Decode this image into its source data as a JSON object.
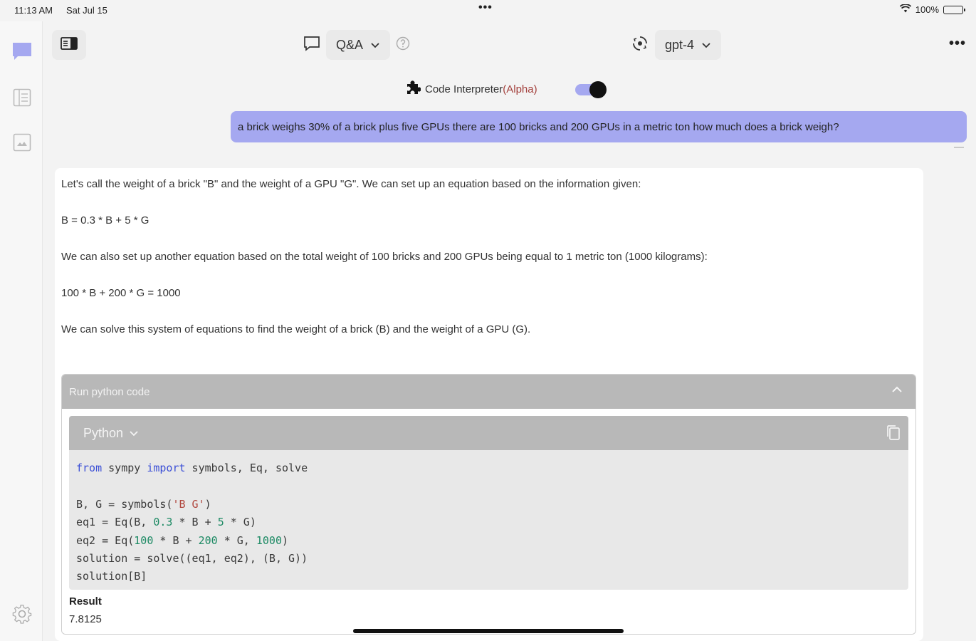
{
  "status_bar": {
    "time": "11:13 AM",
    "date": "Sat Jul 15",
    "dots": "•••",
    "battery": "100%"
  },
  "rail": {
    "icons": [
      "chat-icon",
      "list-icon",
      "image-icon",
      "gear-icon"
    ]
  },
  "toolbar": {
    "mode_label": "Q&A",
    "model_label": "gpt-4",
    "more": "•••"
  },
  "plugin": {
    "name": "Code Interpreter",
    "tag": "(Alpha)",
    "enabled": true
  },
  "user_message": "a brick weighs 30% of a brick plus five GPUs there are 100 bricks and 200 GPUs in a metric ton how much does a brick weigh?",
  "assistant": {
    "paragraphs": [
      "Let's call the weight of a brick \"B\" and the weight of a GPU \"G\". We can set up an equation based on the information given:",
      "B = 0.3 * B + 5 * G",
      "We can also set up another equation based on the total weight of 100 bricks and 200 GPUs being equal to 1 metric ton (1000 kilograms):",
      "100 * B + 200 * G = 1000",
      "We can solve this system of equations to find the weight of a brick (B) and the weight of a GPU (G)."
    ],
    "run_panel": {
      "title": "Run python code",
      "language": "Python",
      "code_lines": [
        [
          {
            "t": "from",
            "c": "kw"
          },
          {
            "t": " sympy ",
            "c": ""
          },
          {
            "t": "import",
            "c": "kw"
          },
          {
            "t": " symbols, Eq, solve",
            "c": ""
          }
        ],
        [],
        [
          {
            "t": "B, G = symbols(",
            "c": ""
          },
          {
            "t": "'B G'",
            "c": "str"
          },
          {
            "t": ")",
            "c": ""
          }
        ],
        [
          {
            "t": "eq1 = Eq(B, ",
            "c": ""
          },
          {
            "t": "0.3",
            "c": "num"
          },
          {
            "t": " * B + ",
            "c": ""
          },
          {
            "t": "5",
            "c": "num"
          },
          {
            "t": " * G)",
            "c": ""
          }
        ],
        [
          {
            "t": "eq2 = Eq(",
            "c": ""
          },
          {
            "t": "100",
            "c": "num"
          },
          {
            "t": " * B + ",
            "c": ""
          },
          {
            "t": "200",
            "c": "num"
          },
          {
            "t": " * G, ",
            "c": ""
          },
          {
            "t": "1000",
            "c": "num"
          },
          {
            "t": ")",
            "c": ""
          }
        ],
        [
          {
            "t": "solution = solve((eq1, eq2), (B, G))",
            "c": ""
          }
        ],
        [
          {
            "t": "solution[B]",
            "c": ""
          }
        ]
      ],
      "result_label": "Result",
      "result_value": "7.8125"
    }
  }
}
